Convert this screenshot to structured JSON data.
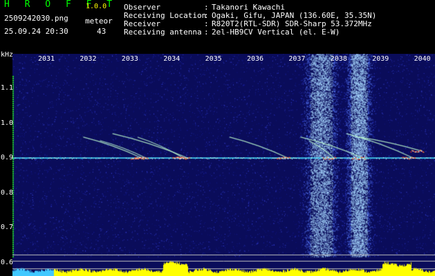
{
  "header": {
    "brand": "H R O F F T",
    "version": "1.0.0",
    "filename": "2509242030.png",
    "datetime": "25.09.24 20:30",
    "meteor_label": "meteor",
    "meteor_count": "43"
  },
  "info": [
    {
      "key": "Observer",
      "value": "Takanori Kawachi"
    },
    {
      "key": "Receiving Location",
      "value": "Ogaki, Gifu, JAPAN (136.60E, 35.35N)"
    },
    {
      "key": "Receiver",
      "value": "R820T2(RTL-SDR) SDR-Sharp 53.372MHz"
    },
    {
      "key": "Receiving antenna",
      "value": "2el-HB9CV Vertical (el. E-W)"
    }
  ],
  "chart_data": {
    "type": "heatmap",
    "ylabel": "kHz",
    "x_ticks": [
      "2031",
      "2032",
      "2033",
      "2034",
      "2035",
      "2036",
      "2037",
      "2038",
      "2039",
      "2040"
    ],
    "y_ticks": [
      "1.1",
      "1.0",
      "0.9",
      "0.8",
      "0.7",
      "0.6"
    ],
    "ylim": [
      0.58,
      1.2
    ],
    "carrier_khz": 0.9,
    "bright_bands_minute": [
      2037.6,
      2038.5
    ],
    "meteor_echoes": [
      {
        "start": [
          2031.9,
          0.96
        ],
        "end": [
          2033.3,
          0.9
        ]
      },
      {
        "start": [
          2032.3,
          0.95
        ],
        "end": [
          2033.4,
          0.9
        ]
      },
      {
        "start": [
          2032.6,
          0.97
        ],
        "end": [
          2034.4,
          0.9
        ]
      },
      {
        "start": [
          2033.2,
          0.96
        ],
        "end": [
          2034.3,
          0.9
        ]
      },
      {
        "start": [
          2035.4,
          0.96
        ],
        "end": [
          2036.8,
          0.9
        ]
      },
      {
        "start": [
          2037.1,
          0.96
        ],
        "end": [
          2038.6,
          0.9
        ]
      },
      {
        "start": [
          2037.3,
          0.95
        ],
        "end": [
          2037.9,
          0.9
        ]
      },
      {
        "start": [
          2038.2,
          0.97
        ],
        "end": [
          2039.8,
          0.9
        ]
      },
      {
        "start": [
          2038.5,
          0.96
        ],
        "end": [
          2040.0,
          0.92
        ]
      }
    ],
    "colors": {
      "background": "#0a0c5a",
      "noise": "#3a46e0",
      "carrier": "#4ff0ff",
      "echo": "#c0ffd0",
      "echo_hot": "#ff3030",
      "power": "#ffff00",
      "power_low": "#40c8ff",
      "axis_text": "#ffffff",
      "brand": "#00ff00"
    }
  }
}
